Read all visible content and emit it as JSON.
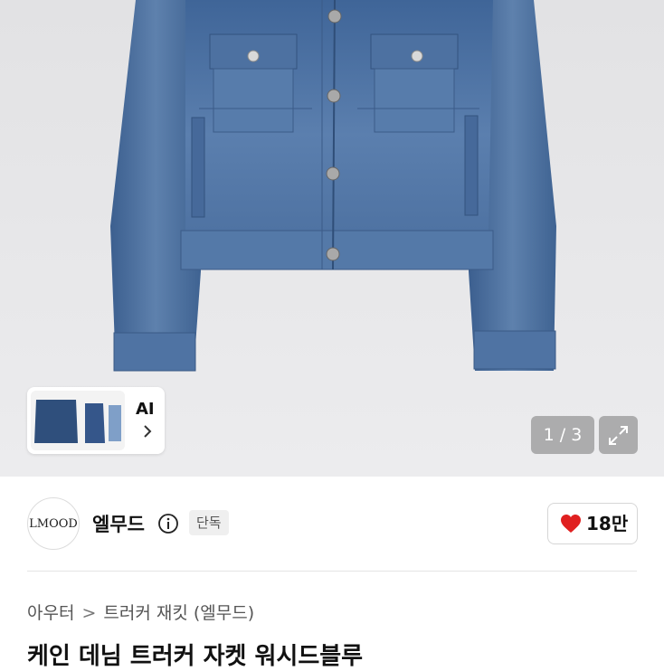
{
  "gallery": {
    "ai_label": "AI",
    "counter": "1 / 3"
  },
  "brand": {
    "logo_text": "LMOOD",
    "name": "엘무드",
    "badge": "단독"
  },
  "like": {
    "count": "18만",
    "color": "#e02020"
  },
  "breadcrumb": {
    "items": [
      "아우터",
      "트러커 재킷 (엘무드)"
    ]
  },
  "product": {
    "title": "케인 데님 트러커 자켓 워시드블루"
  },
  "colors": {
    "denim": "#4a6fa0",
    "hero_bg": "#e6e6e8"
  }
}
